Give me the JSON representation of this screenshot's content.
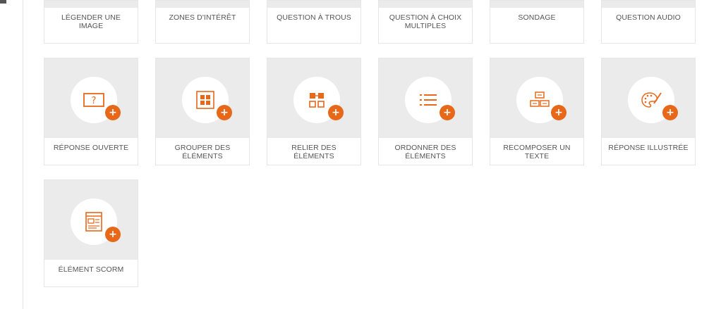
{
  "accent_color": "#e8681a",
  "plus_glyph": "+",
  "top_row": [
    {
      "label": "LÉGENDER UNE IMAGE"
    },
    {
      "label": "ZONES D'INTÉRÊT"
    },
    {
      "label": "QUESTION À TROUS"
    },
    {
      "label": "QUESTION À CHOIX MULTIPLES"
    },
    {
      "label": "SONDAGE"
    },
    {
      "label": "QUESTION AUDIO"
    }
  ],
  "cards": [
    {
      "label": "RÉPONSE OUVERTE",
      "icon": "open-question-icon"
    },
    {
      "label": "GROUPER DES ÉLÉMENTS",
      "icon": "grid-group-icon"
    },
    {
      "label": "RELIER DES ÉLÉMENTS",
      "icon": "link-elements-icon"
    },
    {
      "label": "ORDONNER DES ÉLÉMENTS",
      "icon": "ordered-list-icon"
    },
    {
      "label": "RECOMPOSER UN TEXTE",
      "icon": "recompose-text-icon"
    },
    {
      "label": "RÉPONSE ILLUSTRÉE",
      "icon": "palette-icon"
    },
    {
      "label": "ÉLÉMENT SCORM",
      "icon": "scorm-window-icon"
    }
  ]
}
